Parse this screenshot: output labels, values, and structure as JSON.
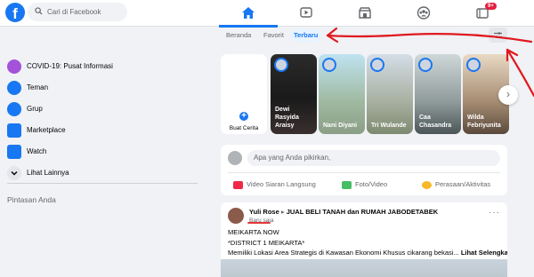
{
  "header": {
    "logo": "f",
    "search_placeholder": "Cari di Facebook",
    "nav": [
      {
        "icon": "home-icon",
        "active": true
      },
      {
        "icon": "watch-icon",
        "active": false
      },
      {
        "icon": "marketplace-icon",
        "active": false
      },
      {
        "icon": "groups-icon",
        "active": false
      },
      {
        "icon": "gaming-icon",
        "active": false,
        "badge": "9+"
      }
    ]
  },
  "sidebar": {
    "items": [
      {
        "label": "COVID-19: Pusat Informasi",
        "icon": "covid-info-icon"
      },
      {
        "label": "Teman",
        "icon": "friends-icon"
      },
      {
        "label": "Grup",
        "icon": "groups-icon"
      },
      {
        "label": "Marketplace",
        "icon": "marketplace-icon"
      },
      {
        "label": "Watch",
        "icon": "watch-icon"
      },
      {
        "label": "Lihat Lainnya",
        "icon": "chevron-down-icon"
      }
    ],
    "shortcuts_title": "Pintasan Anda"
  },
  "feed_tabs": {
    "home": "Beranda",
    "favorites": "Favorit",
    "recent": "Terbaru"
  },
  "stories": {
    "create_label": "Buat Cerita",
    "items": [
      {
        "name": "Dewi Rasyida Araisy"
      },
      {
        "name": "Nani Diyani"
      },
      {
        "name": "Tri Wulande"
      },
      {
        "name": "Caa Chasandra"
      },
      {
        "name": "Wilda Febriyunita"
      }
    ],
    "next_arrow": "›"
  },
  "composer": {
    "placeholder": "Apa yang Anda pikirkan,",
    "live_video": "Video Siaran Langsung",
    "photo_video": "Foto/Video",
    "feeling": "Perasaan/Aktivitas"
  },
  "post": {
    "author": "Yuli Rose",
    "group": "JUAL BELI TANAH dan RUMAH JABODETABEK",
    "time": "Baru saja",
    "more": "···",
    "lines": [
      "MEIKARTA NOW",
      "*DISTRICT 1 MEIKARTA*",
      "Memiliki Lokasi Area Strategis di Kawasan Ekonomi Khusus cikarang bekasi..."
    ],
    "see_more": "Lihat Selengkapnya"
  },
  "colors": {
    "brand": "#1877f2",
    "annotation": "#e0191f",
    "badge": "#e41e3f"
  }
}
